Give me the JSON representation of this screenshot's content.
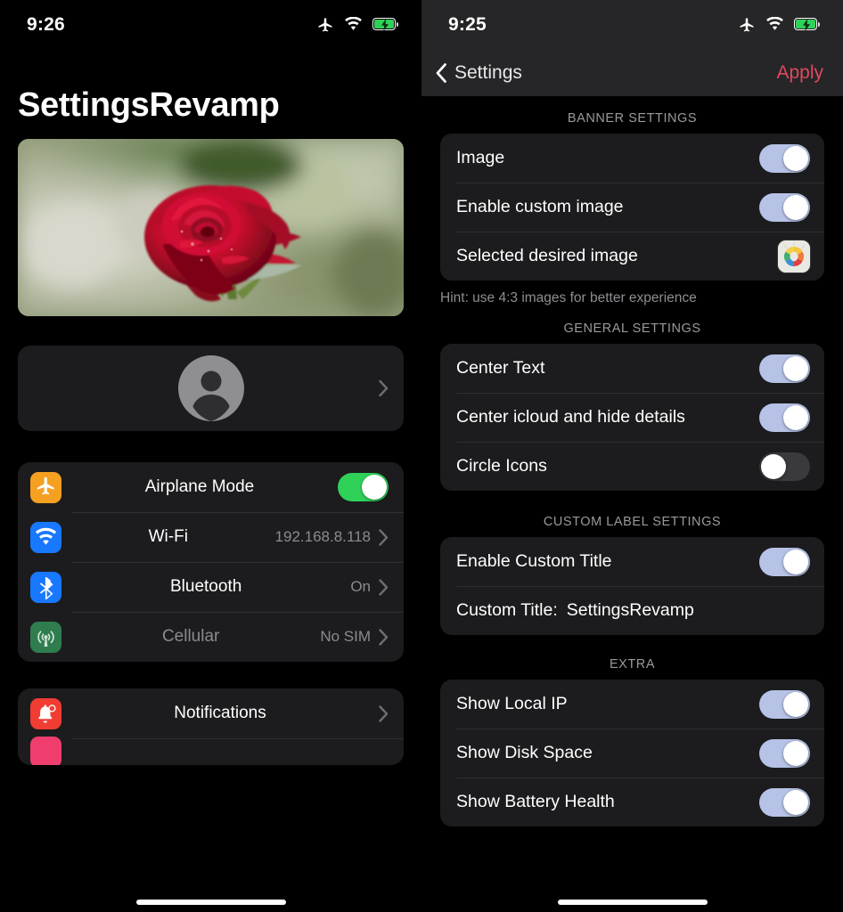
{
  "left": {
    "status": {
      "time": "9:26",
      "icons": [
        "airplane-icon",
        "wifi-icon",
        "battery-charging-icon"
      ]
    },
    "app_title": "SettingsRevamp",
    "banner": {
      "name": "red-rose-banner-image",
      "alt": "Red rose photograph with blurred green background"
    },
    "profile": {
      "name": "apple-account-row",
      "avatar": "person-avatar-icon",
      "chevron": "chevron-right-icon"
    },
    "connectivity_rows": [
      {
        "label": "Airplane Mode",
        "icon": "airplane-icon",
        "icon_color": "#f5a021",
        "control": "toggle",
        "toggle_on": true,
        "toggle_color": "#30d158",
        "dim": false
      },
      {
        "label": "Wi-Fi",
        "icon": "wifi-icon",
        "icon_color": "#1878ff",
        "control": "value",
        "value": "192.168.8.118",
        "dim": false
      },
      {
        "label": "Bluetooth",
        "icon": "bluetooth-icon",
        "icon_color": "#1878ff",
        "control": "value",
        "value": "On",
        "dim": false
      },
      {
        "label": "Cellular",
        "icon": "cellular-icon",
        "icon_color": "#2f7d4f",
        "control": "value",
        "value": "No SIM",
        "dim": true
      }
    ],
    "second_list_rows": [
      {
        "label": "Notifications",
        "icon": "notifications-bell-icon",
        "icon_color": "#f03c32",
        "control": "value",
        "value": ""
      }
    ],
    "partial_icon_below": {
      "name": "sounds-haptics-icon",
      "color": "#ef3e6d"
    }
  },
  "right": {
    "status": {
      "time": "9:25",
      "icons": [
        "airplane-icon",
        "wifi-icon",
        "battery-charging-icon"
      ]
    },
    "nav": {
      "back_label": "Settings",
      "back_icon": "chevron-left-icon",
      "apply_label": "Apply",
      "apply_color": "#e0485f"
    },
    "sections": [
      {
        "header": "BANNER SETTINGS",
        "rows": [
          {
            "label": "Image",
            "control": "toggle",
            "toggle_on": true,
            "toggle_style": "periwinkle"
          },
          {
            "label": "Enable custom image",
            "control": "toggle",
            "toggle_on": true,
            "toggle_style": "periwinkle"
          },
          {
            "label": "Selected desired image",
            "control": "thumbnail",
            "thumbnail": "photos-app-thumbnail"
          }
        ],
        "footer": "Hint: use 4:3 images for better experience"
      },
      {
        "header": "GENERAL SETTINGS",
        "rows": [
          {
            "label": "Center Text",
            "control": "toggle",
            "toggle_on": true,
            "toggle_style": "periwinkle"
          },
          {
            "label": "Center icloud and hide details",
            "control": "toggle",
            "toggle_on": true,
            "toggle_style": "periwinkle"
          },
          {
            "label": "Circle Icons",
            "control": "toggle",
            "toggle_on": false,
            "toggle_style": "dark"
          }
        ],
        "footer": ""
      },
      {
        "header": "CUSTOM LABEL SETTINGS",
        "rows": [
          {
            "label": "Enable Custom Title",
            "control": "toggle",
            "toggle_on": true,
            "toggle_style": "periwinkle"
          },
          {
            "label": "Custom Title:",
            "control": "text-value",
            "value": "SettingsRevamp"
          }
        ],
        "footer": ""
      },
      {
        "header": "EXTRA",
        "rows": [
          {
            "label": "Show Local IP",
            "control": "toggle",
            "toggle_on": true,
            "toggle_style": "periwinkle"
          },
          {
            "label": "Show Disk Space",
            "control": "toggle",
            "toggle_on": true,
            "toggle_style": "periwinkle"
          },
          {
            "label": "Show Battery Health",
            "control": "toggle",
            "toggle_on": true,
            "toggle_style": "periwinkle"
          }
        ],
        "footer": ""
      }
    ]
  },
  "colors": {
    "background": "#000000",
    "card": "#1c1c1e",
    "navbar": "#262628",
    "toggle_on_green": "#30d158",
    "toggle_on_periwinkle": "#b6c2e6",
    "toggle_off": "#3a3a3c",
    "accent_apply": "#e0485f",
    "secondary_text": "#8e8e93"
  }
}
